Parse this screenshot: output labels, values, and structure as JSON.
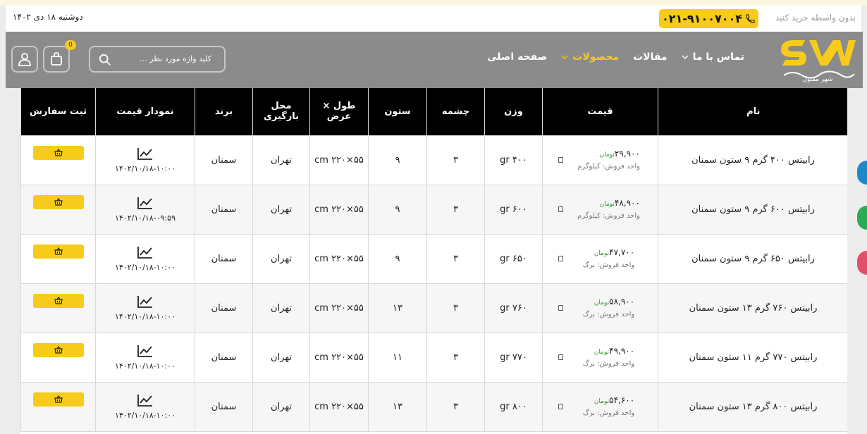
{
  "topbar": {
    "date": "دوشنبه ۱۸ دی ۱۴۰۲",
    "note": "بدون واسطه خرید کنید",
    "phone": "۰۲۱-۹۱۰۰۷۰۰۴"
  },
  "logo": {
    "text": "شهر مفتول"
  },
  "nav": [
    {
      "label": "صفحه اصلی",
      "dropdown": false,
      "active": false
    },
    {
      "label": "محصولات",
      "dropdown": true,
      "active": true
    },
    {
      "label": "مقالات",
      "dropdown": false,
      "active": false
    },
    {
      "label": "تماس با ما",
      "dropdown": true,
      "active": false
    }
  ],
  "search": {
    "placeholder": "کلید واژه مورد نظر ..."
  },
  "cart": {
    "count": "0"
  },
  "colors": {
    "accent": "#f7cb1c",
    "header": "#8b8b8b",
    "currency": "#2e9a2e"
  },
  "table": {
    "headers": [
      "نام",
      "قیمت",
      "وزن",
      "چشمه",
      "ستون",
      "طول × عرض",
      "محل بارگیری",
      "برند",
      "نمودار قیمت",
      "ثبت سفارش"
    ],
    "currency": "تومان",
    "unit_prefix": "واحد فروش:",
    "rows": [
      {
        "name": "رابیتس ۴۰۰ گرم ۹ ستون سمنان",
        "price": "۲۹,۹۰۰",
        "unit": "کیلوگرم",
        "weight": "۴۰۰ gr",
        "mesh": "۳",
        "column": "۹",
        "size": "۵۵×۲۲۰ cm",
        "location": "تهران",
        "brand": "سمنان",
        "date": "۱۴۰۲/۱۰/۱۸-۱۰:۰۰"
      },
      {
        "name": "رابیتس ۶۰۰ گرم ۹ ستون سمنان",
        "price": "۴۸,۹۰۰",
        "unit": "کیلوگرم",
        "weight": "۶۰۰ gr",
        "mesh": "۳",
        "column": "۹",
        "size": "۵۵×۲۲۰ cm",
        "location": "تهران",
        "brand": "سمنان",
        "date": "۱۴۰۲/۱۰/۱۸-۰۹:۵۹"
      },
      {
        "name": "رابیتس ۶۵۰ گرم ۹ ستون سمنان",
        "price": "۴۷,۷۰۰",
        "unit": "برگ",
        "weight": "۶۵۰ gr",
        "mesh": "۳",
        "column": "۹",
        "size": "۵۵×۲۲۰ cm",
        "location": "تهران",
        "brand": "سمنان",
        "date": "۱۴۰۲/۱۰/۱۸-۱۰:۰۰"
      },
      {
        "name": "رابیتس ۷۶۰ گرم ۱۳ ستون سمنان",
        "price": "۵۸,۹۰۰",
        "unit": "برگ",
        "weight": "۷۶۰ gr",
        "mesh": "۳",
        "column": "۱۳",
        "size": "۵۵×۲۲۰ cm",
        "location": "تهران",
        "brand": "سمنان",
        "date": "۱۴۰۲/۱۰/۱۸-۱۰:۰۰"
      },
      {
        "name": "رابیتس ۷۷۰ گرم ۱۱ ستون سمنان",
        "price": "۴۹,۹۰۰",
        "unit": "برگ",
        "weight": "۷۷۰ gr",
        "mesh": "۳",
        "column": "۱۱",
        "size": "۵۵×۲۲۰ cm",
        "location": "تهران",
        "brand": "سمنان",
        "date": "۱۴۰۲/۱۰/۱۸-۱۰:۰۰"
      },
      {
        "name": "رابیتس ۸۰۰ گرم ۱۳ ستون سمنان",
        "price": "۵۴,۶۰۰",
        "unit": "برگ",
        "weight": "۸۰۰ gr",
        "mesh": "۳",
        "column": "۱۳",
        "size": "۵۵×۲۲۰ cm",
        "location": "تهران",
        "brand": "سمنان",
        "date": "۱۴۰۲/۱۰/۱۸-۱۰:۰۰"
      }
    ]
  }
}
